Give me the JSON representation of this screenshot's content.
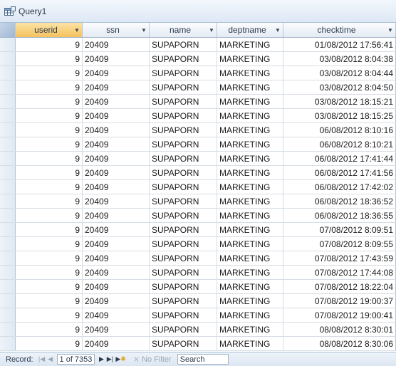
{
  "window": {
    "title": "Query1",
    "icon": "query-table-icon"
  },
  "columns": [
    {
      "key": "userid",
      "label": "userid"
    },
    {
      "key": "ssn",
      "label": "ssn"
    },
    {
      "key": "name",
      "label": "name"
    },
    {
      "key": "deptname",
      "label": "deptname"
    },
    {
      "key": "checktime",
      "label": "checktime"
    }
  ],
  "rows": [
    {
      "userid": "9",
      "ssn": "20409",
      "name": "SUPAPORN",
      "deptname": "MARKETING",
      "checktime": "01/08/2012 17:56:41"
    },
    {
      "userid": "9",
      "ssn": "20409",
      "name": "SUPAPORN",
      "deptname": "MARKETING",
      "checktime": "03/08/2012 8:04:38"
    },
    {
      "userid": "9",
      "ssn": "20409",
      "name": "SUPAPORN",
      "deptname": "MARKETING",
      "checktime": "03/08/2012 8:04:44"
    },
    {
      "userid": "9",
      "ssn": "20409",
      "name": "SUPAPORN",
      "deptname": "MARKETING",
      "checktime": "03/08/2012 8:04:50"
    },
    {
      "userid": "9",
      "ssn": "20409",
      "name": "SUPAPORN",
      "deptname": "MARKETING",
      "checktime": "03/08/2012 18:15:21"
    },
    {
      "userid": "9",
      "ssn": "20409",
      "name": "SUPAPORN",
      "deptname": "MARKETING",
      "checktime": "03/08/2012 18:15:25"
    },
    {
      "userid": "9",
      "ssn": "20409",
      "name": "SUPAPORN",
      "deptname": "MARKETING",
      "checktime": "06/08/2012 8:10:16"
    },
    {
      "userid": "9",
      "ssn": "20409",
      "name": "SUPAPORN",
      "deptname": "MARKETING",
      "checktime": "06/08/2012 8:10:21"
    },
    {
      "userid": "9",
      "ssn": "20409",
      "name": "SUPAPORN",
      "deptname": "MARKETING",
      "checktime": "06/08/2012 17:41:44"
    },
    {
      "userid": "9",
      "ssn": "20409",
      "name": "SUPAPORN",
      "deptname": "MARKETING",
      "checktime": "06/08/2012 17:41:56"
    },
    {
      "userid": "9",
      "ssn": "20409",
      "name": "SUPAPORN",
      "deptname": "MARKETING",
      "checktime": "06/08/2012 17:42:02"
    },
    {
      "userid": "9",
      "ssn": "20409",
      "name": "SUPAPORN",
      "deptname": "MARKETING",
      "checktime": "06/08/2012 18:36:52"
    },
    {
      "userid": "9",
      "ssn": "20409",
      "name": "SUPAPORN",
      "deptname": "MARKETING",
      "checktime": "06/08/2012 18:36:55"
    },
    {
      "userid": "9",
      "ssn": "20409",
      "name": "SUPAPORN",
      "deptname": "MARKETING",
      "checktime": "07/08/2012 8:09:51"
    },
    {
      "userid": "9",
      "ssn": "20409",
      "name": "SUPAPORN",
      "deptname": "MARKETING",
      "checktime": "07/08/2012 8:09:55"
    },
    {
      "userid": "9",
      "ssn": "20409",
      "name": "SUPAPORN",
      "deptname": "MARKETING",
      "checktime": "07/08/2012 17:43:59"
    },
    {
      "userid": "9",
      "ssn": "20409",
      "name": "SUPAPORN",
      "deptname": "MARKETING",
      "checktime": "07/08/2012 17:44:08"
    },
    {
      "userid": "9",
      "ssn": "20409",
      "name": "SUPAPORN",
      "deptname": "MARKETING",
      "checktime": "07/08/2012 18:22:04"
    },
    {
      "userid": "9",
      "ssn": "20409",
      "name": "SUPAPORN",
      "deptname": "MARKETING",
      "checktime": "07/08/2012 19:00:37"
    },
    {
      "userid": "9",
      "ssn": "20409",
      "name": "SUPAPORN",
      "deptname": "MARKETING",
      "checktime": "07/08/2012 19:00:41"
    },
    {
      "userid": "9",
      "ssn": "20409",
      "name": "SUPAPORN",
      "deptname": "MARKETING",
      "checktime": "08/08/2012 8:30:01"
    },
    {
      "userid": "9",
      "ssn": "20409",
      "name": "SUPAPORN",
      "deptname": "MARKETING",
      "checktime": "08/08/2012 8:30:06"
    }
  ],
  "statusbar": {
    "record_label": "Record:",
    "record_position": "1 of 7353",
    "filter_label": "No Filter",
    "search_placeholder": "Search"
  },
  "colors": {
    "selected_header": "#f5c25c",
    "header_bg": "#e4ebf4",
    "grid_line": "#d7dde5"
  }
}
